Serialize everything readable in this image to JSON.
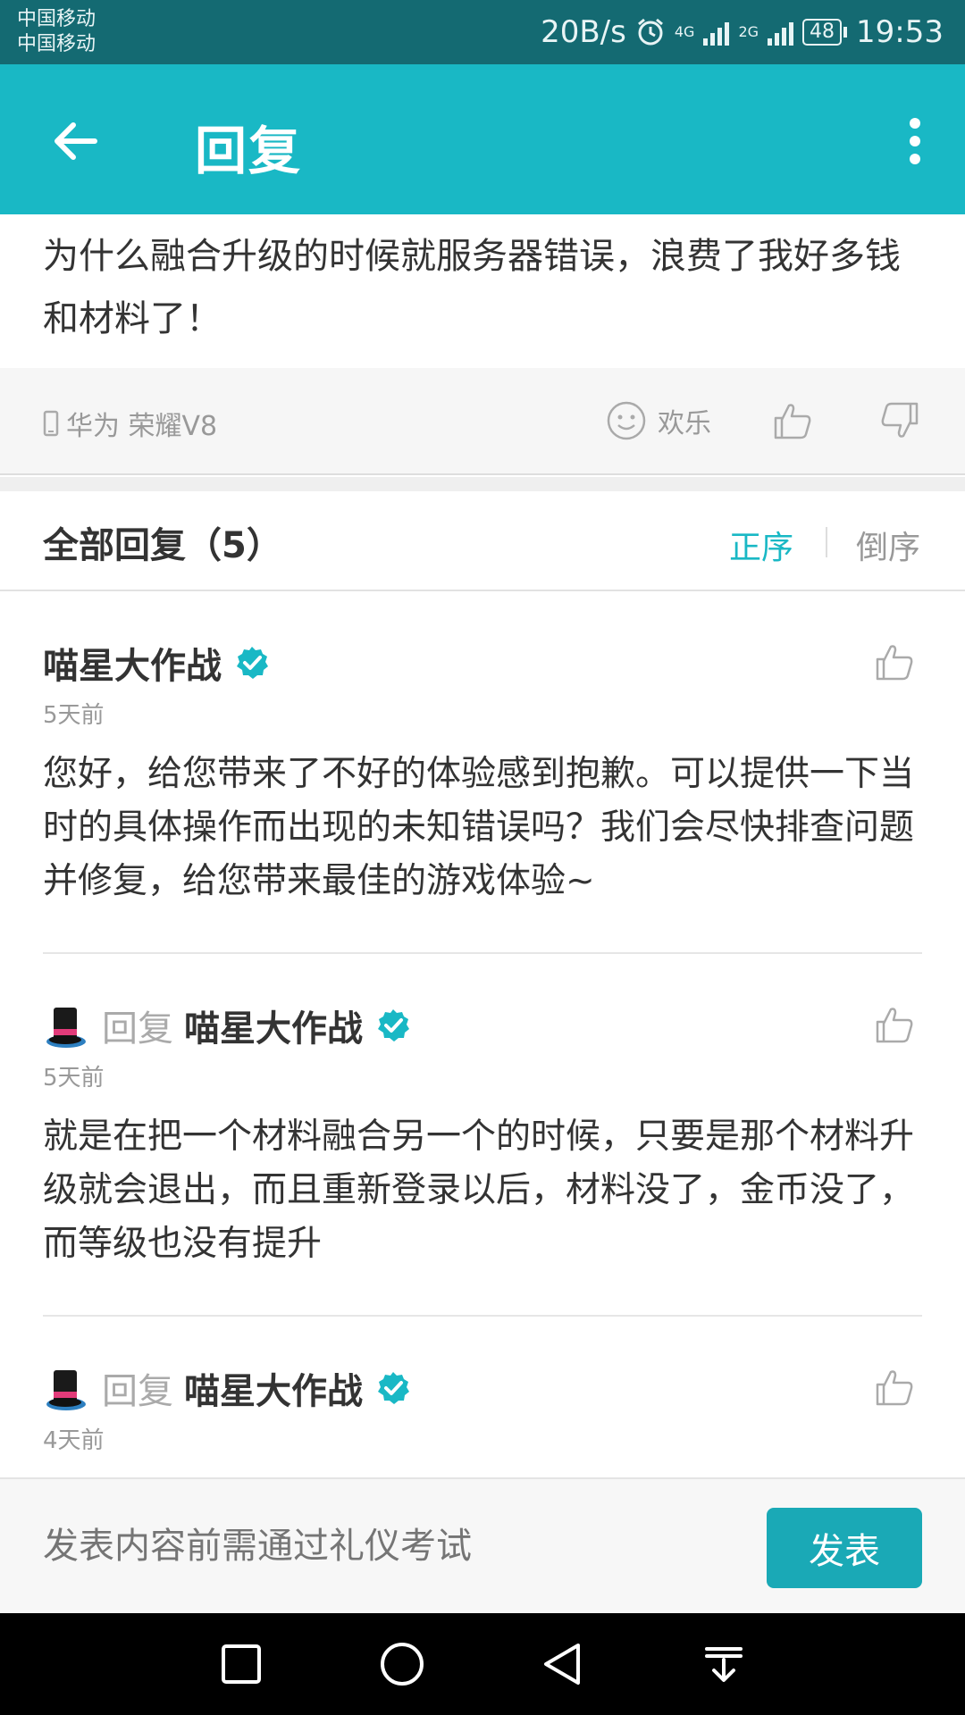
{
  "status_bar": {
    "carrier_1": "中国移动",
    "carrier_2": "中国移动",
    "net_speed": "20B/s",
    "sim1_type": "4G",
    "sim2_type": "2G",
    "battery": "48",
    "time": "19:53"
  },
  "app_bar": {
    "title": "回复"
  },
  "post": {
    "body": "为什么融合升级的时候就服务器错误，浪费了我好多钱和材料了！",
    "device": "华为 荣耀V8",
    "mood": "欢乐"
  },
  "replies_header": {
    "title": "全部回复（5）",
    "sort_asc": "正序",
    "sort_desc": "倒序"
  },
  "replies": [
    {
      "author": "喵星大作战",
      "time": "5天前",
      "text": "您好，给您带来了不好的体验感到抱歉。可以提供一下当时的具体操作而出现的未知错误吗？我们会尽快排查问题并修复，给您带来最佳的游戏体验~"
    },
    {
      "reply_word": "回复",
      "author": "喵星大作战",
      "time": "5天前",
      "text": "就是在把一个材料融合另一个的时候，只要是那个材料升级就会退出，而且重新登录以后，材料没了，金币没了，而等级也没有提升"
    },
    {
      "reply_word": "回复",
      "author": "喵星大作战",
      "time": "4天前"
    }
  ],
  "compose": {
    "placeholder": "发表内容前需通过礼仪考试",
    "send_label": "发表"
  },
  "colors": {
    "status_bar": "#146a72",
    "app_bar": "#19b8c5",
    "accent": "#19b8c5",
    "send_button": "#1aa9b6"
  }
}
